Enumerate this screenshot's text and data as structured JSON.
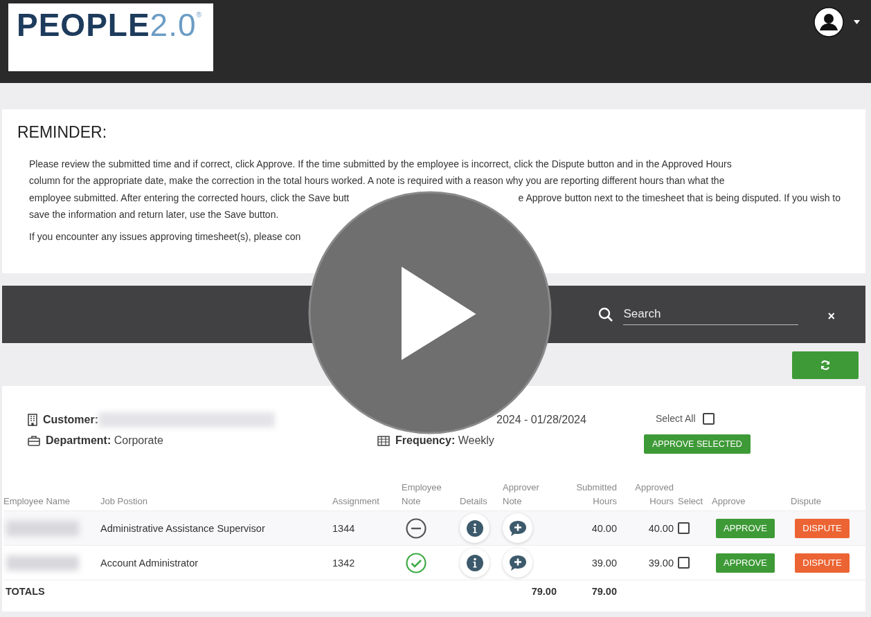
{
  "header": {
    "logo": {
      "word": "PEOPLE",
      "version": "2.0",
      "mark": "®"
    }
  },
  "reminder": {
    "title": "REMINDER:",
    "lines": [
      {
        "left": "Please review the submitted time and if correct, click Approve. If the time submitted by the employee is incorrect, click the Dispute button and in the Approved Hours"
      },
      {
        "left": "column for the appropriate date, make the correction in the total hours worked. A note is required with a reason why you are reporting different hours than what the"
      },
      {
        "left": "employee submitted. After entering the corrected hours, click the Save butt",
        "right": "e Approve button next to the timesheet that is being disputed. If you wish to"
      },
      {
        "left": "save the information and return later, use the Save button."
      }
    ],
    "contact_line": "If you encounter any issues approving timesheet(s), please con"
  },
  "toolbar": {
    "search": {
      "placeholder": "Search"
    },
    "clear": "×"
  },
  "summary": {
    "customer_label": "Customer:",
    "department_label": "Department:",
    "department": "Corporate",
    "period": "2024 - 01/28/2024",
    "frequency_label": "Frequency:",
    "frequency": "Weekly",
    "select_all": {
      "label": "Select All",
      "checked": false
    },
    "approve_selected": "APPROVE SELECTED"
  },
  "table": {
    "columns": [
      {
        "lines": [
          "Employee Name"
        ]
      },
      {
        "lines": [
          "Job Postion"
        ]
      },
      {
        "lines": [
          "Assignment"
        ]
      },
      {
        "lines": [
          "Employee",
          "Note"
        ]
      },
      {
        "lines": [
          "Details"
        ]
      },
      {
        "lines": [
          "Approver",
          "Note"
        ]
      },
      {
        "lines": [
          "Submitted",
          "Hours"
        ]
      },
      {
        "lines": [
          "Approved",
          "Hours"
        ]
      },
      {
        "lines": [
          "Select"
        ]
      },
      {
        "lines": [
          "Approve"
        ]
      },
      {
        "lines": [
          "Dispute"
        ]
      }
    ],
    "rows": [
      {
        "job": "Administrative Assistance Supervisor",
        "assignment": "1344",
        "employee_note": {
          "kind": "none"
        },
        "submitted": "40.00",
        "approved": "40.00",
        "checked": false,
        "approve": "APPROVE",
        "dispute": "DISPUTE"
      },
      {
        "job": "Account Administrator",
        "assignment": "1342",
        "employee_note": {
          "kind": "check"
        },
        "submitted": "39.00",
        "approved": "39.00",
        "checked": false,
        "approve": "APPROVE",
        "dispute": "DISPUTE"
      }
    ],
    "totals": {
      "label": "TOTALS",
      "submitted": "79.00",
      "approved": "79.00"
    }
  }
}
